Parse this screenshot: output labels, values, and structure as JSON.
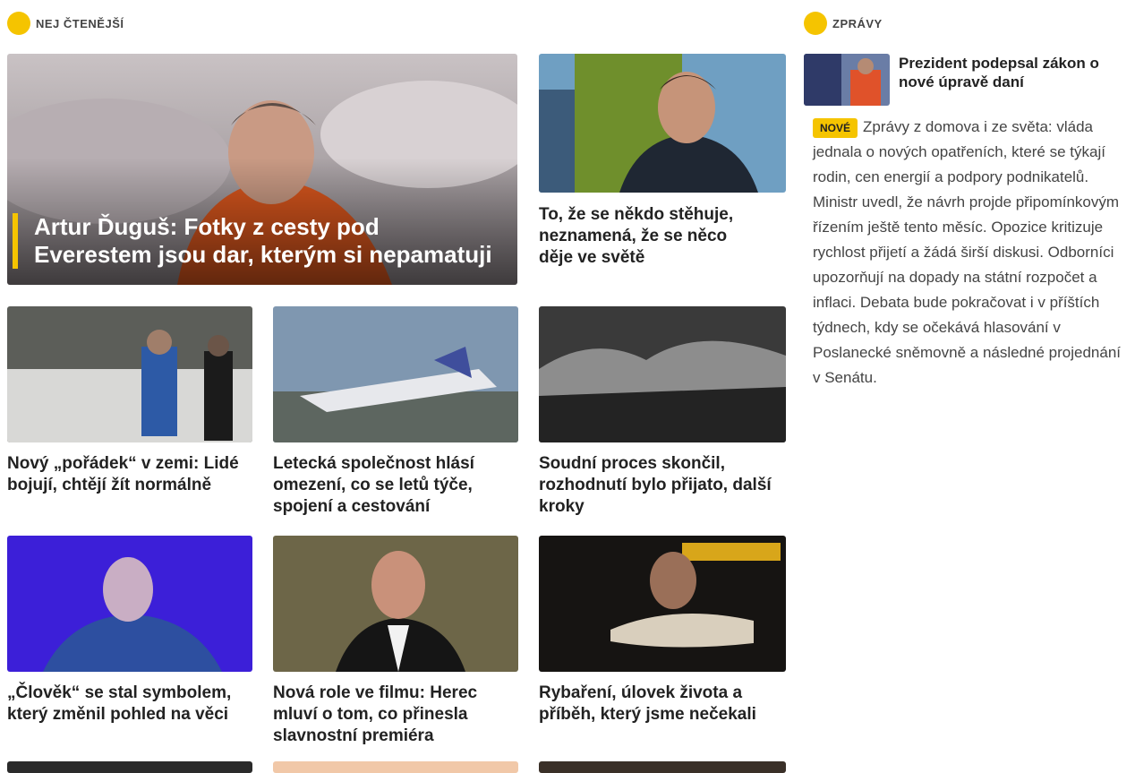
{
  "sections": {
    "left_label": "NEJ ČTENĚJŠÍ",
    "right_label": "ZPRÁVY"
  },
  "hero": {
    "headline": "Artur Ďuguš: Fotky z cesty pod Everestem jsou dar, kterým si nepamatuji"
  },
  "articles": [
    {
      "headline": "To, že se někdo stěhuje, neznamená, že se něco děje ve světě"
    },
    {
      "headline": "Nový „pořádek“ v zemi: Lidé bojují, chtějí žít normálně"
    },
    {
      "headline": "Letecká společnost hlásí omezení, co se letů týče, spojení a cestování"
    },
    {
      "headline": "Soudní proces skončil, rozhodnutí bylo přijato, další kroky"
    },
    {
      "headline": "„Člověk“ se stal symbolem, který změnil pohled na věci"
    },
    {
      "headline": "Nová role ve filmu: Herec mluví o tom, co přinesla slavnostní premiéra"
    },
    {
      "headline": "Rybaření, úlovek života a příběh, který jsme nečekali"
    }
  ],
  "news": {
    "top_headline": "Prezident podepsal zákon o nové úpravě daní",
    "badge": "NOVÉ",
    "text": "Zprávy z domova i ze světa: vláda jednala o nových opatřeních, které se týkají rodin, cen energií a podpory podnikatelů. Ministr uvedl, že návrh projde připomínkovým řízením ještě tento měsíc. Opozice kritizuje rychlost přijetí a žádá širší diskusi. Odborníci upozorňují na dopady na státní rozpočet a inflaci. Debata bude pokračovat i v příštích týdnech, kdy se očekává hlasování v Poslanecké sněmovně a následné projednání v Senátu."
  },
  "colors": {
    "accent": "#f5c400"
  }
}
